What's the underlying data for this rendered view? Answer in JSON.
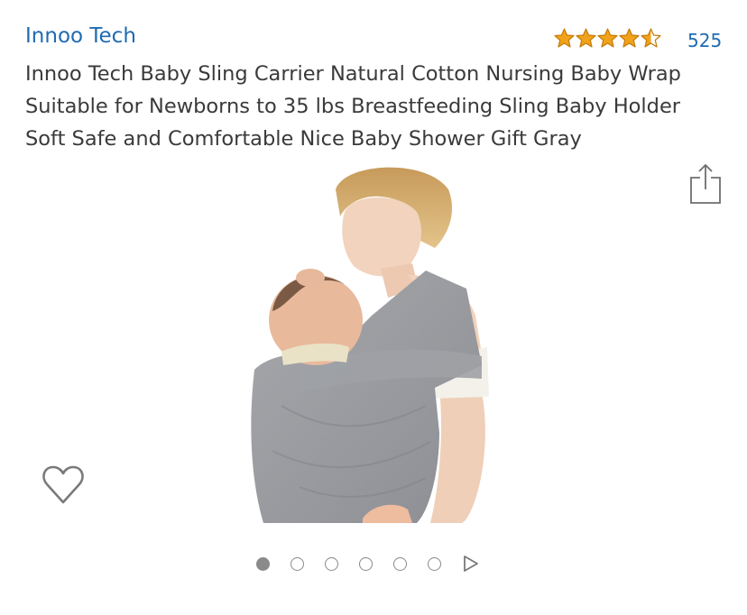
{
  "brand": {
    "name": "Innoo Tech"
  },
  "rating": {
    "stars": 4.5,
    "max_stars": 5,
    "review_count": "525",
    "star_color": "#f0a31a"
  },
  "product": {
    "title_lines": [
      "Innoo Tech Baby Sling Carrier Natural Cotton Nursing Baby Wrap",
      "Suitable for Newborns to 35 lbs Breastfeeding Sling Baby Holder",
      "Soft Safe and Comfortable Nice Baby Shower Gift Gray"
    ]
  },
  "gallery": {
    "image_count": 6,
    "active_index": 0
  },
  "icons": {
    "share": "share-icon",
    "wishlist": "heart-outline-icon",
    "next": "play-triangle-icon"
  },
  "colors": {
    "link": "#1f6bb1",
    "title_text": "#3a3a3a",
    "dot": "#8a8a8a",
    "fabric": "#9a9ca0"
  }
}
